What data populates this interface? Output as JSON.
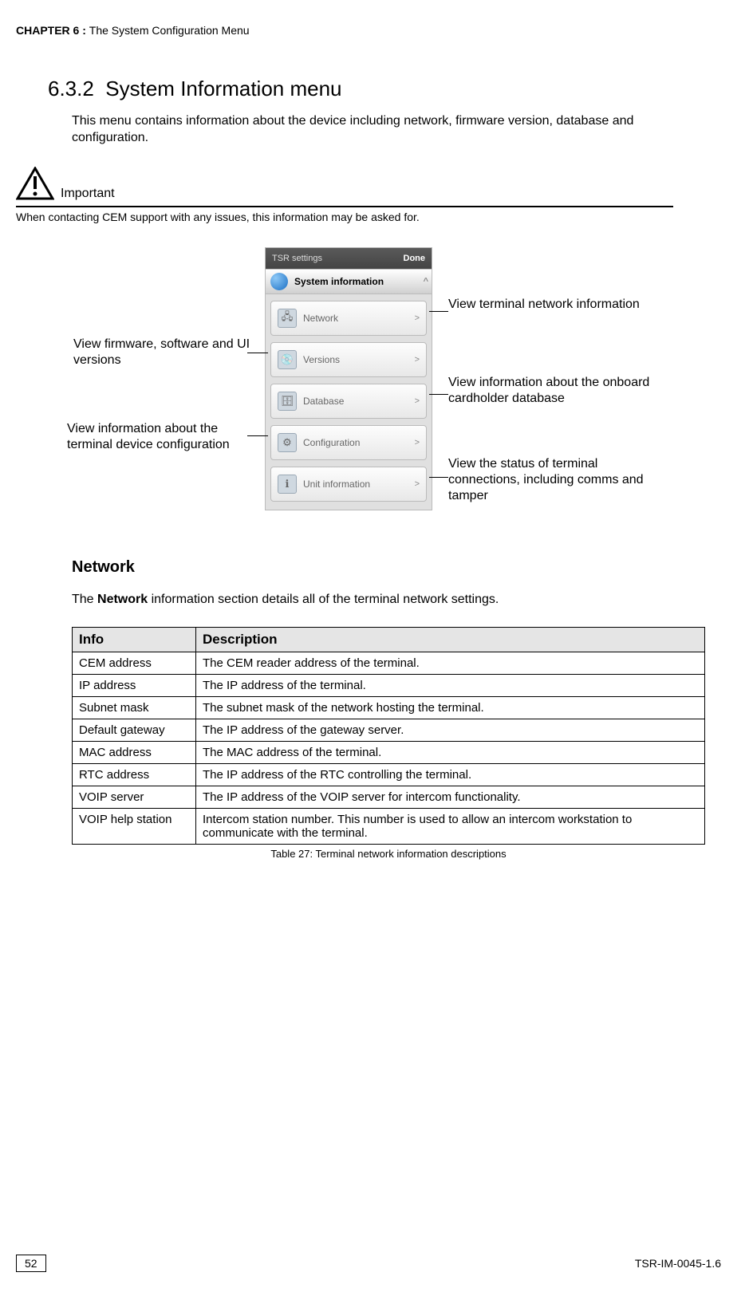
{
  "header": {
    "chapter_prefix": "CHAPTER  6 : ",
    "chapter_title": "The System Configuration Menu"
  },
  "section": {
    "number": "6.3.2",
    "title": "System Information menu",
    "intro": "This menu contains information about the device including network, firmware version, database and configuration."
  },
  "important": {
    "label": "Important",
    "text": "When contacting CEM support with any issues, this information may be asked for."
  },
  "screenshot": {
    "titlebar_left": "TSR settings",
    "titlebar_right": "Done",
    "section_header": "System information",
    "items": [
      {
        "label": "Network"
      },
      {
        "label": "Versions"
      },
      {
        "label": "Database"
      },
      {
        "label": "Configuration"
      },
      {
        "label": "Unit information"
      }
    ]
  },
  "callouts": {
    "network": "View terminal network information",
    "versions": "View firmware, software and UI versions",
    "database": "View information about the onboard cardholder database",
    "configuration": "View information about the terminal device configuration",
    "unit_info": "View the status of terminal connections, including comms and tamper"
  },
  "network_section": {
    "heading": "Network",
    "intro_prefix": "The ",
    "intro_bold": "Network",
    "intro_suffix": " information section details all of the terminal network settings."
  },
  "table": {
    "head_info": "Info",
    "head_desc": "Description",
    "rows": [
      {
        "info": "CEM address",
        "desc": "The CEM reader address of the terminal."
      },
      {
        "info": "IP address",
        "desc": "The IP address of the terminal."
      },
      {
        "info": "Subnet mask",
        "desc": "The subnet mask of the network hosting the terminal."
      },
      {
        "info": "Default gateway",
        "desc": "The IP address of the gateway server."
      },
      {
        "info": "MAC address",
        "desc": "The MAC address of the terminal."
      },
      {
        "info": "RTC address",
        "desc": "The IP address of the RTC controlling the terminal."
      },
      {
        "info": "VOIP server",
        "desc": "The IP address of the VOIP server for intercom functionality."
      },
      {
        "info": "VOIP help station",
        "desc": "Intercom station number. This number is used to allow an intercom workstation to communicate with the terminal."
      }
    ],
    "caption": "Table 27: Terminal network information descriptions"
  },
  "footer": {
    "page": "52",
    "docid": "TSR-IM-0045-1.6"
  }
}
